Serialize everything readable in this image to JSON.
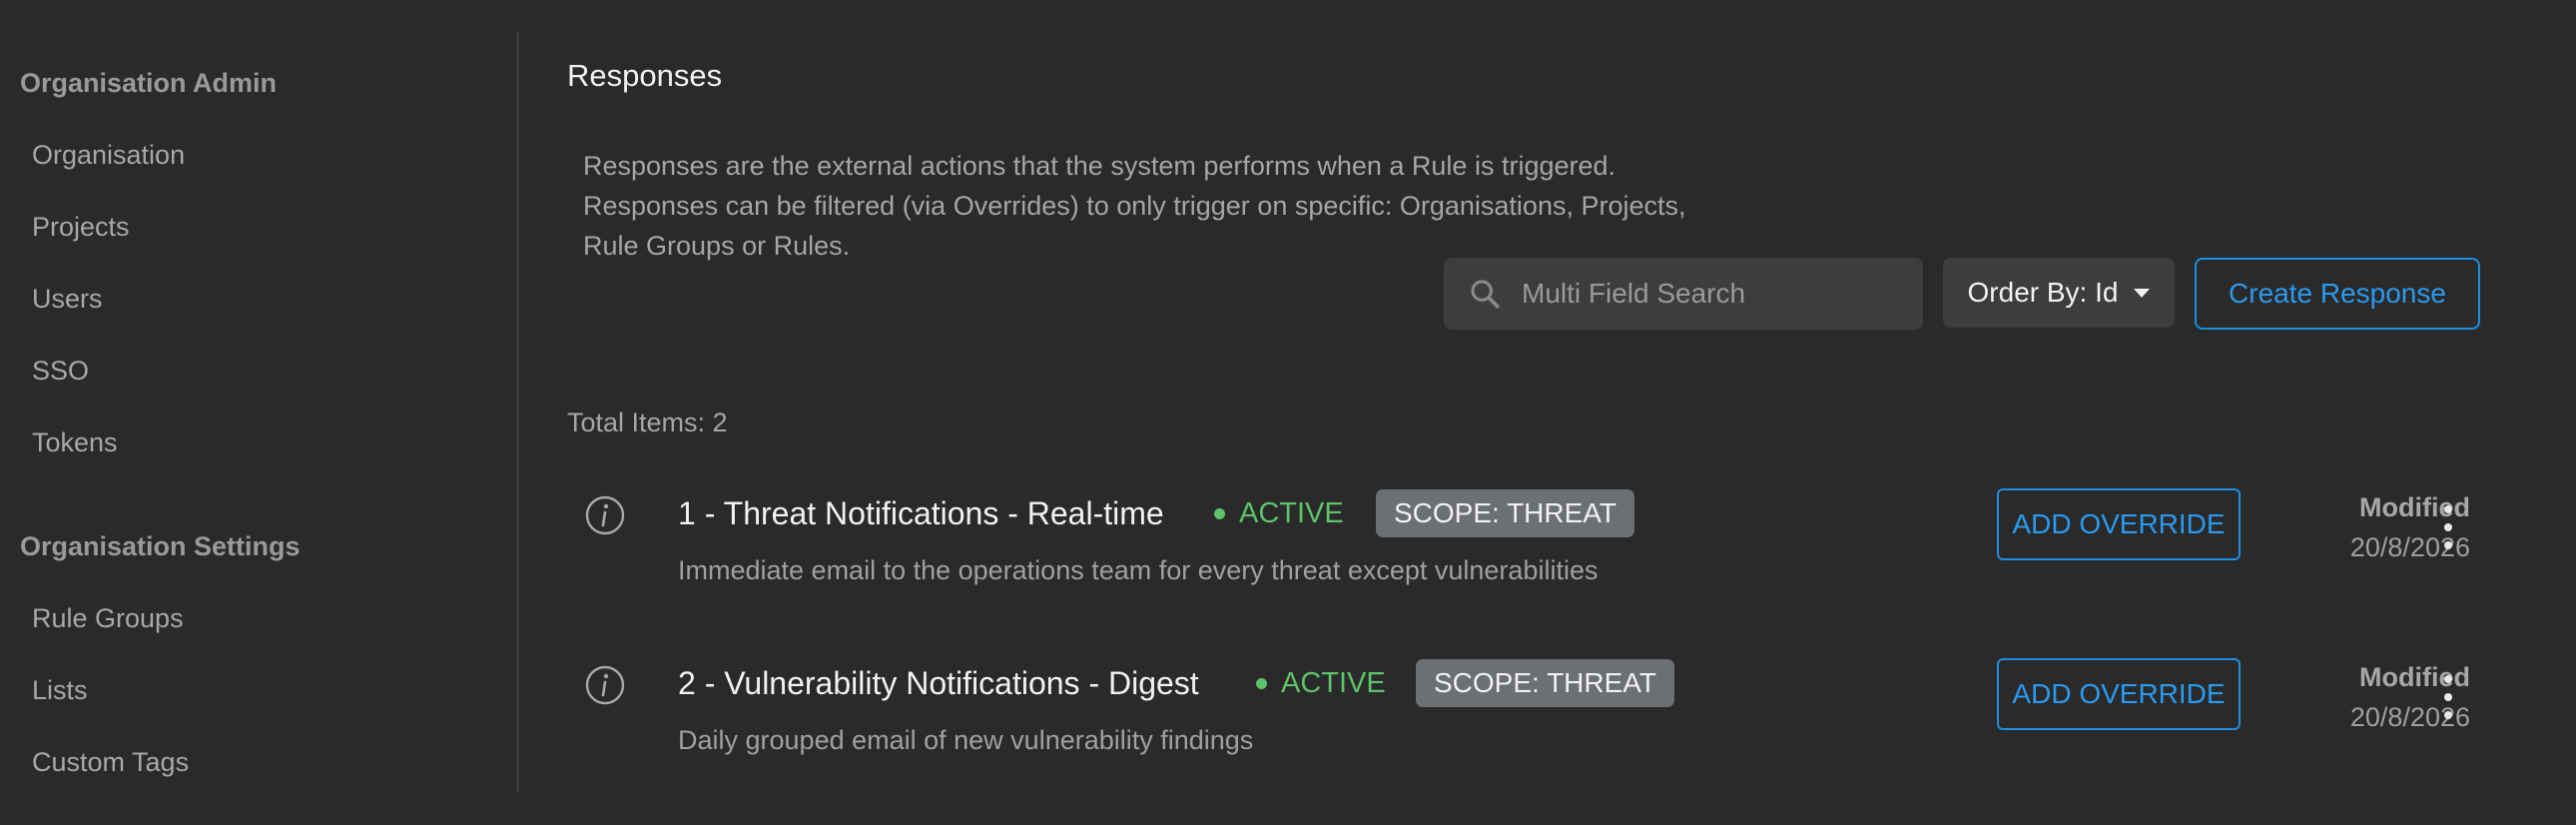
{
  "sidebar": {
    "sections": [
      {
        "title": "Organisation Admin",
        "items": [
          "Organisation",
          "Projects",
          "Users",
          "SSO",
          "Tokens"
        ]
      },
      {
        "title": "Organisation Settings",
        "items": [
          "Rule Groups",
          "Lists",
          "Custom Tags"
        ]
      }
    ]
  },
  "main": {
    "title": "Responses",
    "description": "Responses are the external actions that the system performs when a Rule is triggered. Responses can be filtered (via Overrides) to only trigger on specific: Organisations, Projects, Rule Groups or Rules.",
    "search": {
      "placeholder": "Multi Field Search",
      "value": ""
    },
    "order_by": "Order By: Id",
    "create_button": "Create Response",
    "total_items": "Total Items: 2",
    "responses": [
      {
        "title": "1 - Threat Notifications - Real-time",
        "status": "ACTIVE",
        "scope": "SCOPE: THREAT",
        "description": "Immediate email to the operations team for every threat except vulnerabilities",
        "override_label": "ADD OVERRIDE",
        "modified_label": "Modified",
        "modified_date": "20/8/2026"
      },
      {
        "title": "2 - Vulnerability Notifications - Digest",
        "status": "ACTIVE",
        "scope": "SCOPE: THREAT",
        "description": "Daily grouped email of new vulnerability findings",
        "override_label": "ADD OVERRIDE",
        "modified_label": "Modified",
        "modified_date": "20/8/2026"
      }
    ]
  },
  "colors": {
    "background": "#2a2a2a",
    "accent": "#2a9af0",
    "active": "#5ec26a",
    "badge": "#6c6f73"
  },
  "icons": [
    "search-icon",
    "info-icon",
    "caret-down-icon",
    "more-vertical-icon"
  ]
}
